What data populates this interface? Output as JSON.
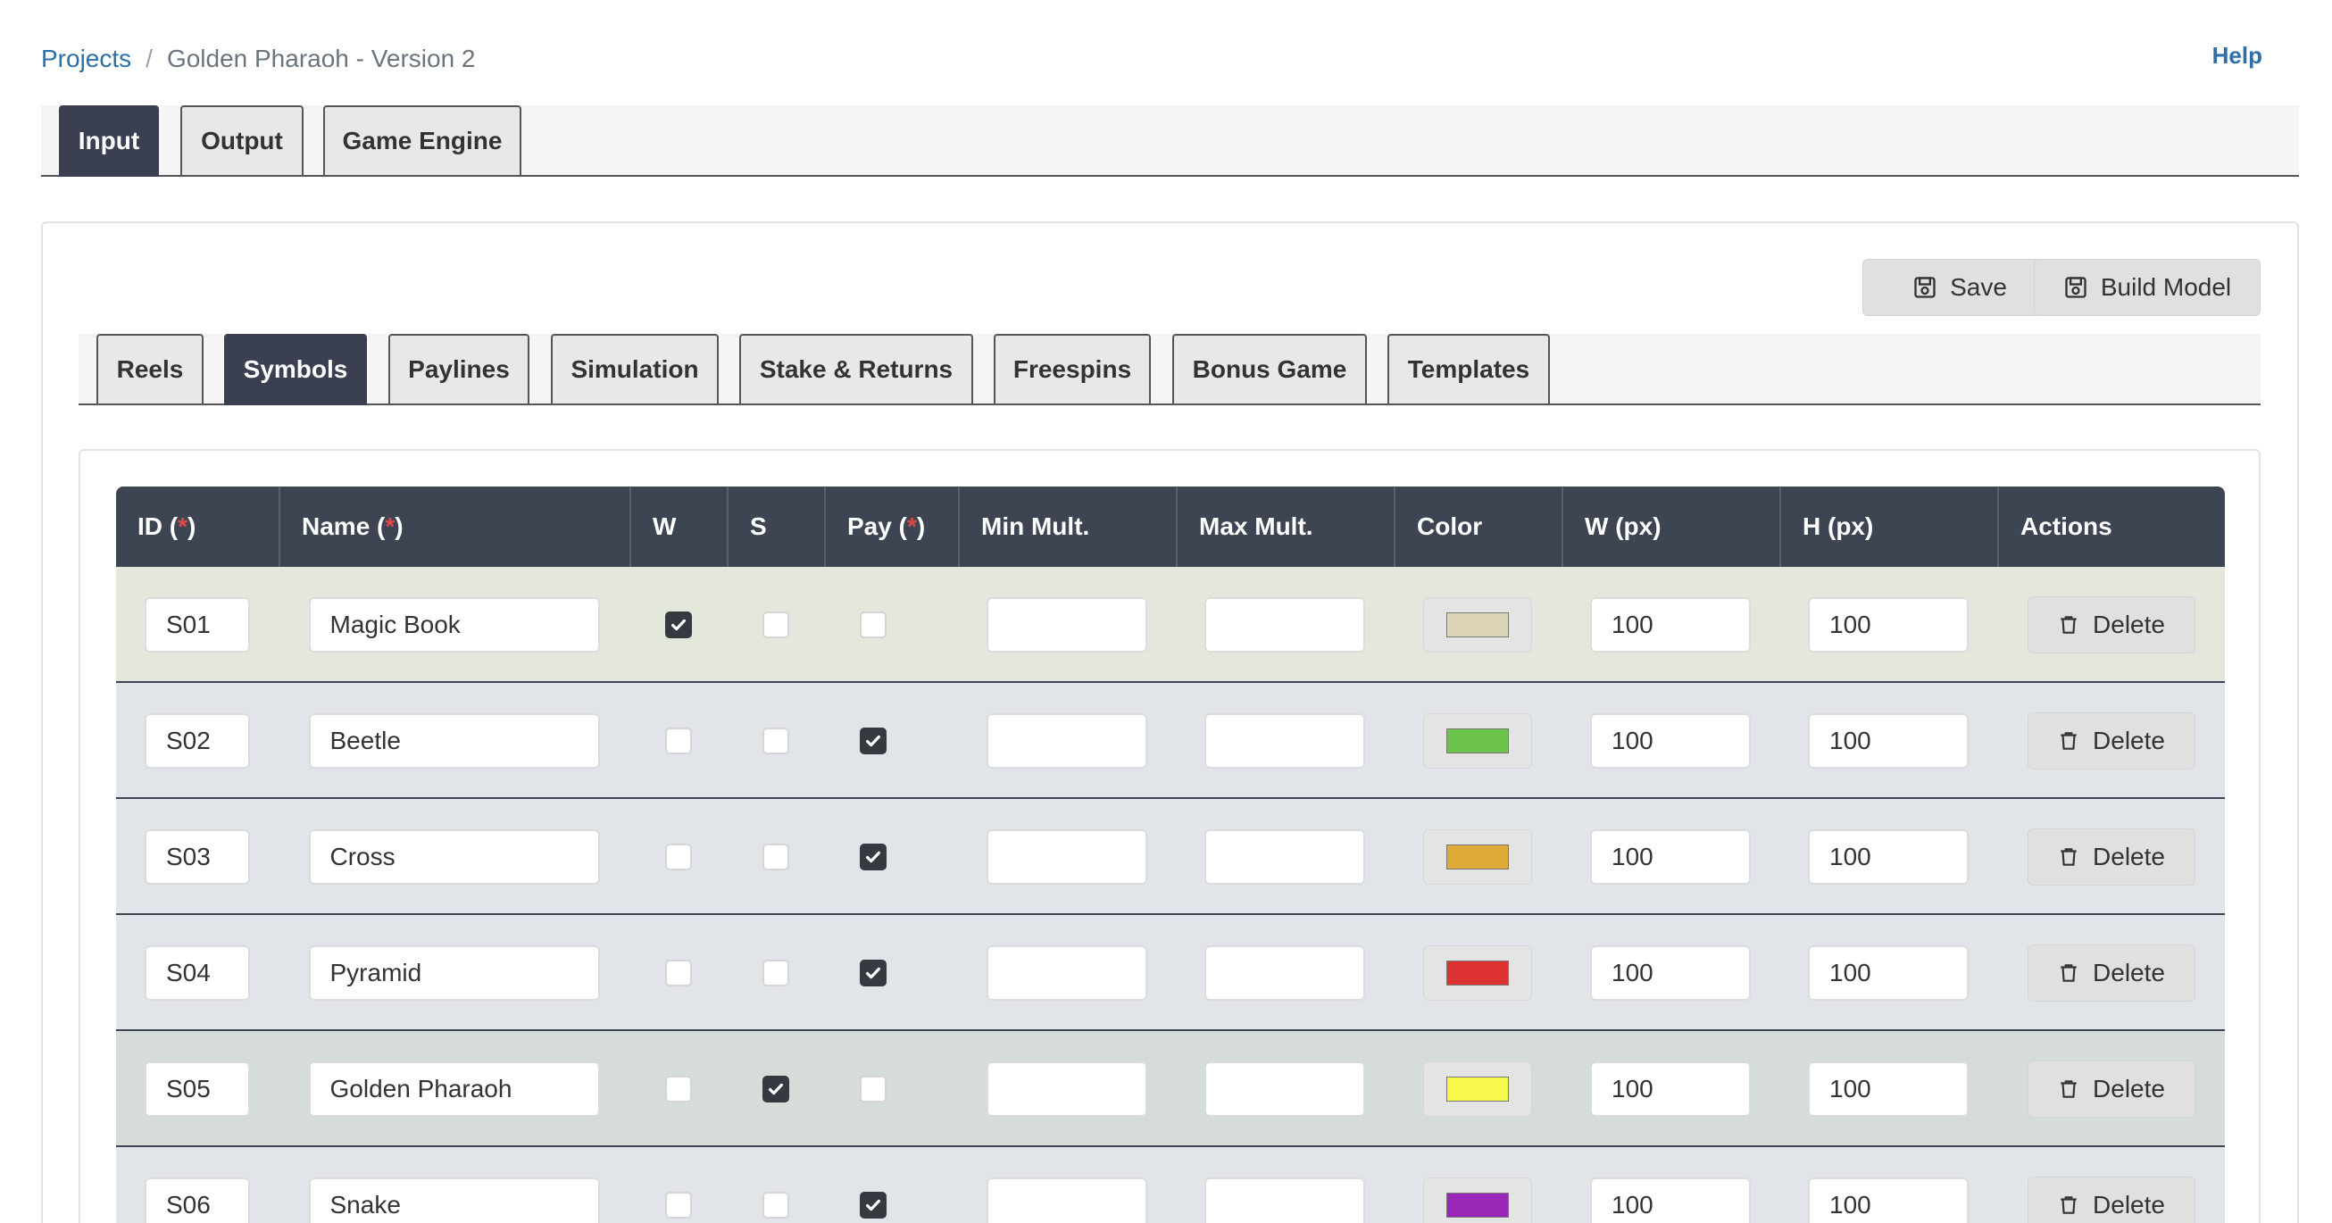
{
  "breadcrumb": {
    "projects": "Projects",
    "separator": "/",
    "current": "Golden Pharaoh - Version 2"
  },
  "help": "Help",
  "top_tabs": [
    {
      "label": "Input",
      "active": true
    },
    {
      "label": "Output",
      "active": false
    },
    {
      "label": "Game Engine",
      "active": false
    }
  ],
  "actions": {
    "save": "Save",
    "build_model": "Build Model"
  },
  "sub_tabs": [
    {
      "label": "Reels",
      "active": false
    },
    {
      "label": "Symbols",
      "active": true
    },
    {
      "label": "Paylines",
      "active": false
    },
    {
      "label": "Simulation",
      "active": false
    },
    {
      "label": "Stake & Returns",
      "active": false
    },
    {
      "label": "Freespins",
      "active": false
    },
    {
      "label": "Bonus Game",
      "active": false
    },
    {
      "label": "Templates",
      "active": false
    }
  ],
  "table": {
    "columns": {
      "id": "ID (",
      "id_req": "*",
      "id_close": ")",
      "name": "Name (",
      "name_req": "*",
      "name_close": ")",
      "w": "W",
      "s": "S",
      "pay": "Pay (",
      "pay_req": "*",
      "pay_close": ")",
      "min_mult": "Min Mult.",
      "max_mult": "Max Mult.",
      "color": "Color",
      "w_px": "W (px)",
      "h_px": "H (px)",
      "actions": "Actions"
    },
    "delete_label": "Delete",
    "rows": [
      {
        "id": "S01",
        "name": "Magic Book",
        "w": true,
        "s": false,
        "pay": false,
        "min_mult": "",
        "max_mult": "",
        "color": "#ddd5b8",
        "w_px": "100",
        "h_px": "100",
        "row_bg": "#e4e8dc"
      },
      {
        "id": "S02",
        "name": "Beetle",
        "w": false,
        "s": false,
        "pay": true,
        "min_mult": "",
        "max_mult": "",
        "color": "#6cc44c",
        "w_px": "100",
        "h_px": "100",
        "row_bg": "#e1e4e9"
      },
      {
        "id": "S03",
        "name": "Cross",
        "w": false,
        "s": false,
        "pay": true,
        "min_mult": "",
        "max_mult": "",
        "color": "#dfa938",
        "w_px": "100",
        "h_px": "100",
        "row_bg": "#e1e4e9"
      },
      {
        "id": "S04",
        "name": "Pyramid",
        "w": false,
        "s": false,
        "pay": true,
        "min_mult": "",
        "max_mult": "",
        "color": "#dd3232",
        "w_px": "100",
        "h_px": "100",
        "row_bg": "#e1e4e9"
      },
      {
        "id": "S05",
        "name": "Golden Pharaoh",
        "w": false,
        "s": true,
        "pay": false,
        "min_mult": "",
        "max_mult": "",
        "color": "#f8f84c",
        "w_px": "100",
        "h_px": "100",
        "row_bg": "#d6dcd8"
      },
      {
        "id": "S06",
        "name": "Snake",
        "w": false,
        "s": false,
        "pay": true,
        "min_mult": "",
        "max_mult": "",
        "color": "#9b27b8",
        "w_px": "100",
        "h_px": "100",
        "row_bg": "#e1e4e9"
      }
    ]
  }
}
